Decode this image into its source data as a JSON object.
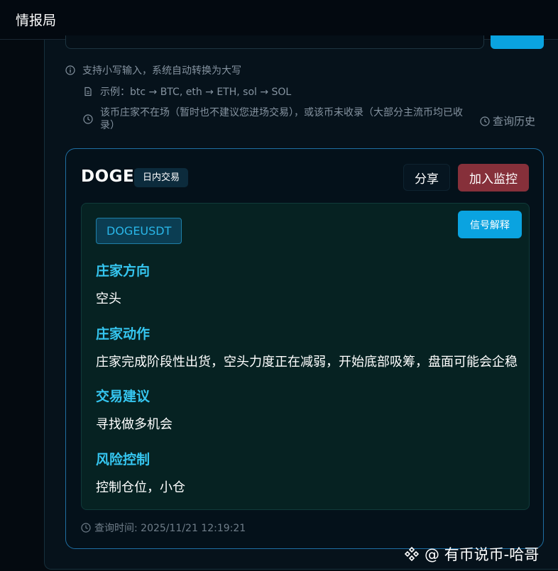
{
  "header": {
    "title": "情报局"
  },
  "hints": {
    "lowercase": "支持小写输入，系统自动转换为大写",
    "example": "示例：btc → BTC, eth → ETH, sol → SOL",
    "absent": "该币庄家不在场（暂时也不建议您进场交易），或该币未收录（大部分主流币均已收录）",
    "history": "查询历史"
  },
  "result": {
    "symbol": "DOGE",
    "type": "日内交易",
    "share_label": "分享",
    "monitor_label": "加入监控",
    "pair": "DOGEUSDT",
    "explain_label": "信号解释",
    "sections": [
      {
        "title": "庄家方向",
        "text": "空头"
      },
      {
        "title": "庄家动作",
        "text": "庄家完成阶段性出货，空头力度正在减弱，开始底部吸筹，盘面可能会企稳"
      },
      {
        "title": "交易建议",
        "text": "寻找做多机会"
      },
      {
        "title": "风险控制",
        "text": "控制仓位，小仓"
      }
    ],
    "query_time": "查询时间: 2025/11/21 12:19:21"
  },
  "watermark": "@ 有币说币-哈哥",
  "colors": {
    "accent": "#0aa3e0",
    "danger": "#86303a",
    "section_title": "#35c6f0"
  }
}
